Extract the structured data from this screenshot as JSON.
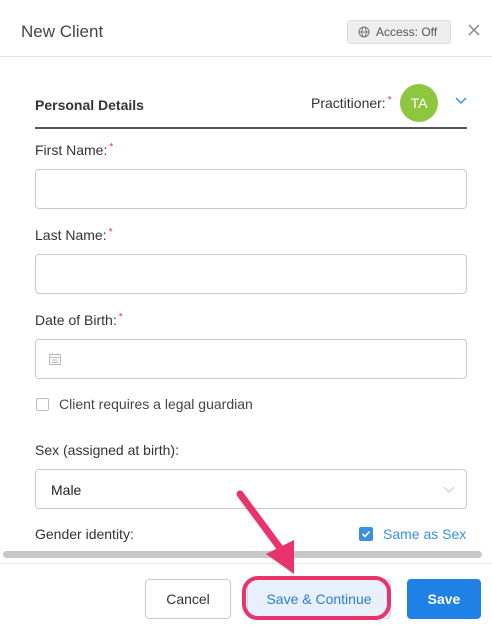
{
  "header": {
    "title": "New Client",
    "access_label": "Access: Off"
  },
  "section": {
    "title": "Personal Details",
    "practitioner_label": "Practitioner:",
    "practitioner_initials": "TA",
    "avatar_color": "#8dc63f"
  },
  "form": {
    "first_name_label": "First Name:",
    "first_name_value": "",
    "last_name_label": "Last Name:",
    "last_name_value": "",
    "dob_label": "Date of Birth:",
    "dob_value": "",
    "guardian_label": "Client requires a legal guardian",
    "guardian_checked": false,
    "sex_label": "Sex (assigned at birth):",
    "sex_value": "Male",
    "gender_label": "Gender identity:",
    "same_as_sex_label": "Same as Sex",
    "same_as_sex_checked": true,
    "required_marker": "*"
  },
  "footer": {
    "cancel_label": "Cancel",
    "save_continue_label": "Save & Continue",
    "save_label": "Save"
  },
  "colors": {
    "accent": "#1f80e6",
    "link_blue": "#3a90e2",
    "highlight": "#e8336b",
    "required": "#e33333"
  }
}
